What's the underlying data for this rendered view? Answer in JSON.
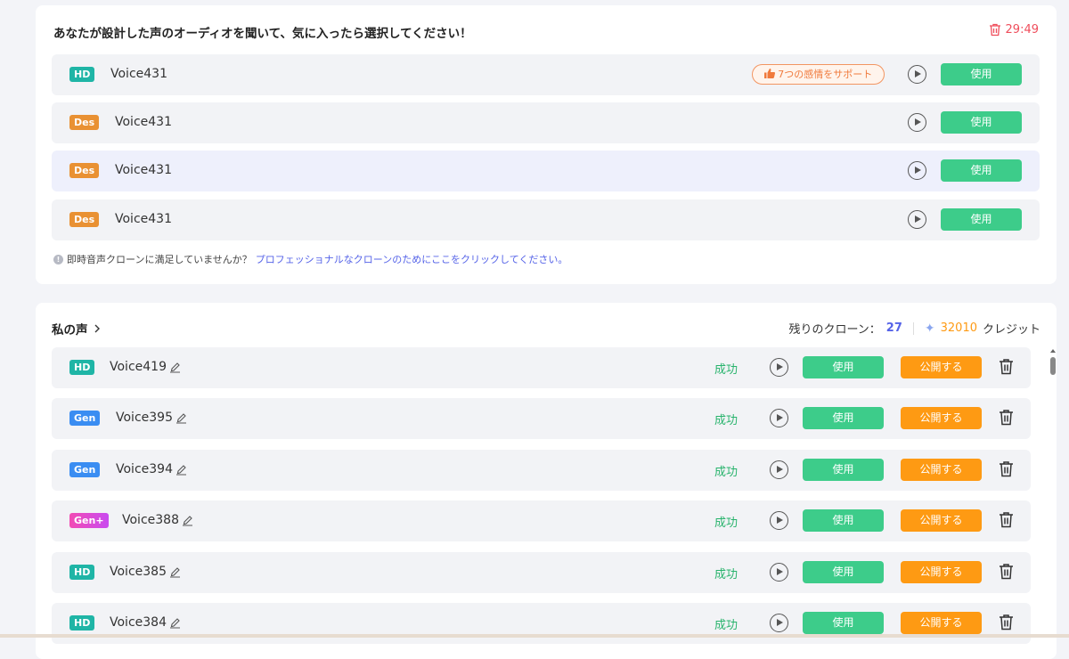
{
  "generated": {
    "title": "あなたが設計した声のオーディオを聞いて、気に入ったら選択してください！",
    "timer": "29:49",
    "emotion_badge": "7つの感情をサポート",
    "rows": [
      {
        "badge": "HD",
        "name": "Voice431",
        "use_label": "使用"
      },
      {
        "badge": "Des",
        "name": "Voice431",
        "use_label": "使用"
      },
      {
        "badge": "Des",
        "name": "Voice431",
        "use_label": "使用"
      },
      {
        "badge": "Des",
        "name": "Voice431",
        "use_label": "使用"
      }
    ],
    "hint_text": "即時音声クローンに満足していませんか？",
    "hint_link": "プロフェッショナルなクローンのためにここをクリックしてください。"
  },
  "my_voices": {
    "title": "私の声",
    "remaining_label": "残りのクローン：",
    "remaining_count": "27",
    "credits": "32010",
    "credits_label": "クレジット",
    "rows": [
      {
        "badge": "HD",
        "name": "Voice419",
        "status": "成功",
        "use_label": "使用",
        "publish_label": "公開する"
      },
      {
        "badge": "Gen",
        "name": "Voice395",
        "status": "成功",
        "use_label": "使用",
        "publish_label": "公開する"
      },
      {
        "badge": "Gen",
        "name": "Voice394",
        "status": "成功",
        "use_label": "使用",
        "publish_label": "公開する"
      },
      {
        "badge": "Gen+",
        "name": "Voice388",
        "status": "成功",
        "use_label": "使用",
        "publish_label": "公開する"
      },
      {
        "badge": "HD",
        "name": "Voice385",
        "status": "成功",
        "use_label": "使用",
        "publish_label": "公開する"
      },
      {
        "badge": "HD",
        "name": "Voice384",
        "status": "成功",
        "use_label": "使用",
        "publish_label": "公開する"
      }
    ]
  },
  "icons": {
    "timer": "trash-icon",
    "emotion": "thumbs-up-icon",
    "play": "play-circle-icon",
    "edit": "pencil-icon",
    "delete": "trash-icon",
    "info": "info-icon",
    "chevron": "chevron-right-icon",
    "credits": "sparkle-icon"
  },
  "colors": {
    "use_button": "#3dcc8a",
    "publish_button": "#fe9a13",
    "success_text": "#28b36c",
    "timer": "#ef4d5b",
    "link": "#5563e8",
    "badge_hd": "#1fb5a6",
    "badge_des": "#e99133",
    "badge_gen": "#3a8df2",
    "badge_gen_plus": "#e04bd0"
  }
}
